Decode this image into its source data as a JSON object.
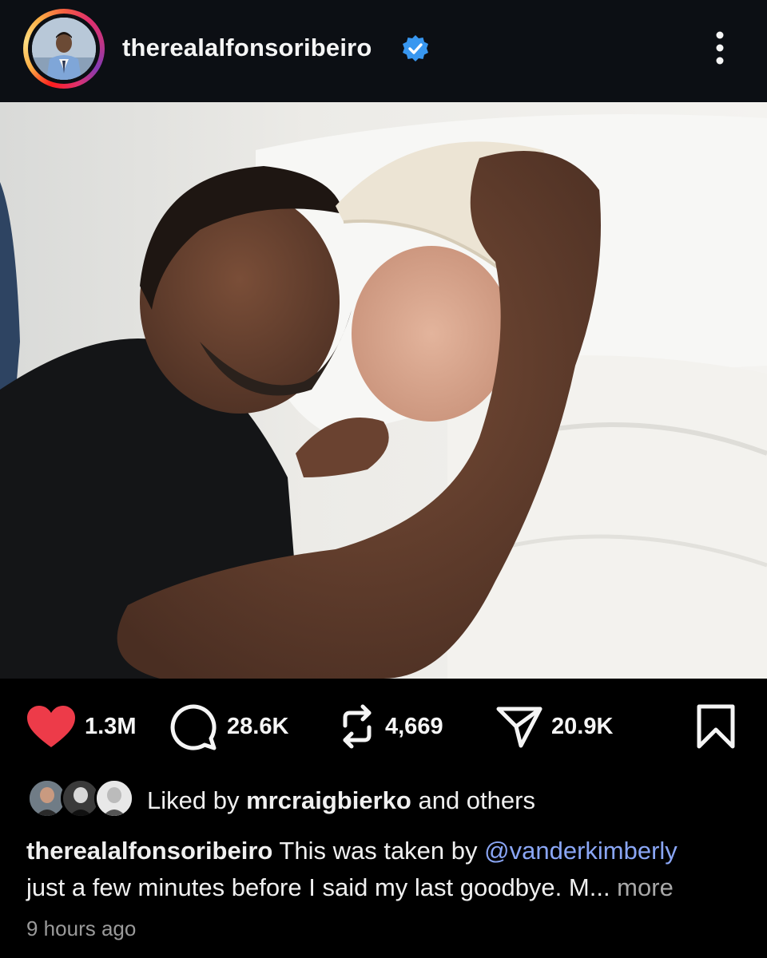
{
  "post": {
    "username": "therealalfonsoribeiro",
    "verified": true,
    "more_icon": "more-vertical-icon",
    "image_alt": "Two men lying together on a hospital bed, foreheads touching"
  },
  "actions": {
    "likes": "1.3M",
    "comments": "28.6K",
    "reposts": "4,669",
    "shares": "20.9K",
    "like_color": "#ed3b49"
  },
  "liked_by": {
    "prefix": "Liked by ",
    "user": "mrcraigbierko",
    "suffix": " and others"
  },
  "caption": {
    "username": "therealalfonsoribeiro",
    "text_before": " This was taken by ",
    "mention": "@vanderkimberly",
    "text_after": "just a few minutes before I said my last goodbye. M...",
    "more": " more"
  },
  "timestamp": "9 hours ago",
  "colors": {
    "background": "#000000",
    "header": "#0c0f14",
    "verified": "#3897f0",
    "mention": "#8aa6f5",
    "muted": "#a8a8a8"
  }
}
